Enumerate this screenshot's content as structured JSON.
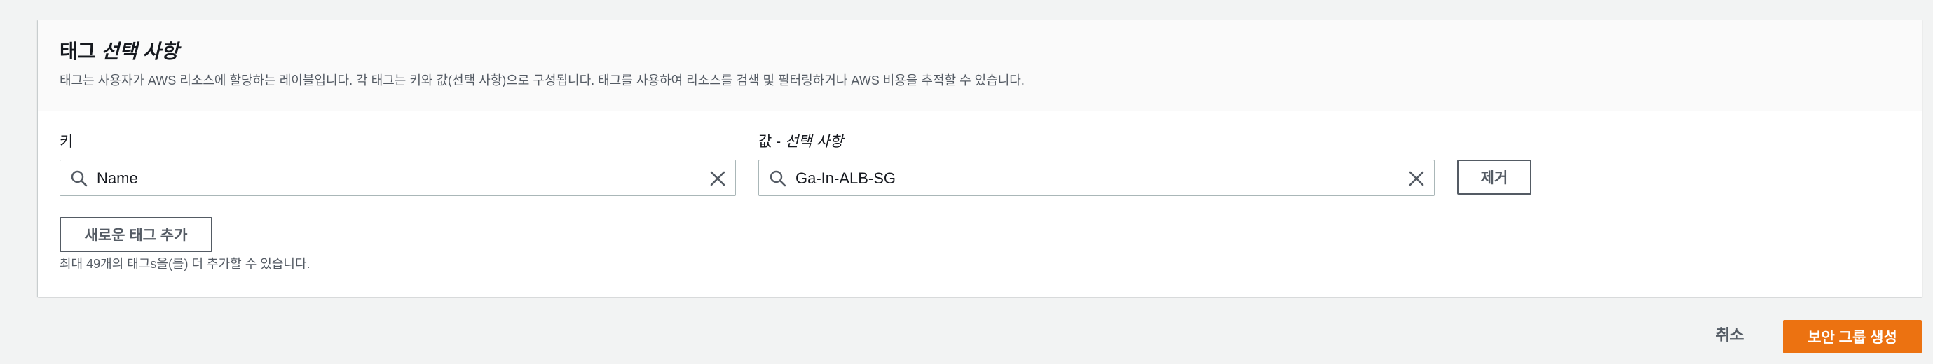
{
  "tags_section": {
    "title_main": "태그",
    "title_optional": "선택 사항",
    "description": "태그는 사용자가 AWS 리소스에 할당하는 레이블입니다. 각 태그는 키와 값(선택 사항)으로 구성됩니다. 태그를 사용하여 리소스를 검색 및 필터링하거나 AWS 비용을 추적할 수 있습니다.",
    "key_label": "키",
    "value_label_main": "값 - ",
    "value_label_optional": "선택 사항",
    "tag_rows": [
      {
        "key": "Name",
        "value": "Ga-In-ALB-SG",
        "remove_label": "제거"
      }
    ],
    "add_tag_label": "새로운 태그 추가",
    "limit_note": "최대 49개의 태그s을(를) 더 추가할 수 있습니다."
  },
  "footer": {
    "cancel_label": "취소",
    "create_label": "보안 그룹 생성"
  },
  "colors": {
    "primary": "#ec7211",
    "border": "#aab7b8",
    "text_secondary": "#545b64"
  },
  "icons": {
    "search": "search-icon",
    "clear": "close-icon"
  }
}
